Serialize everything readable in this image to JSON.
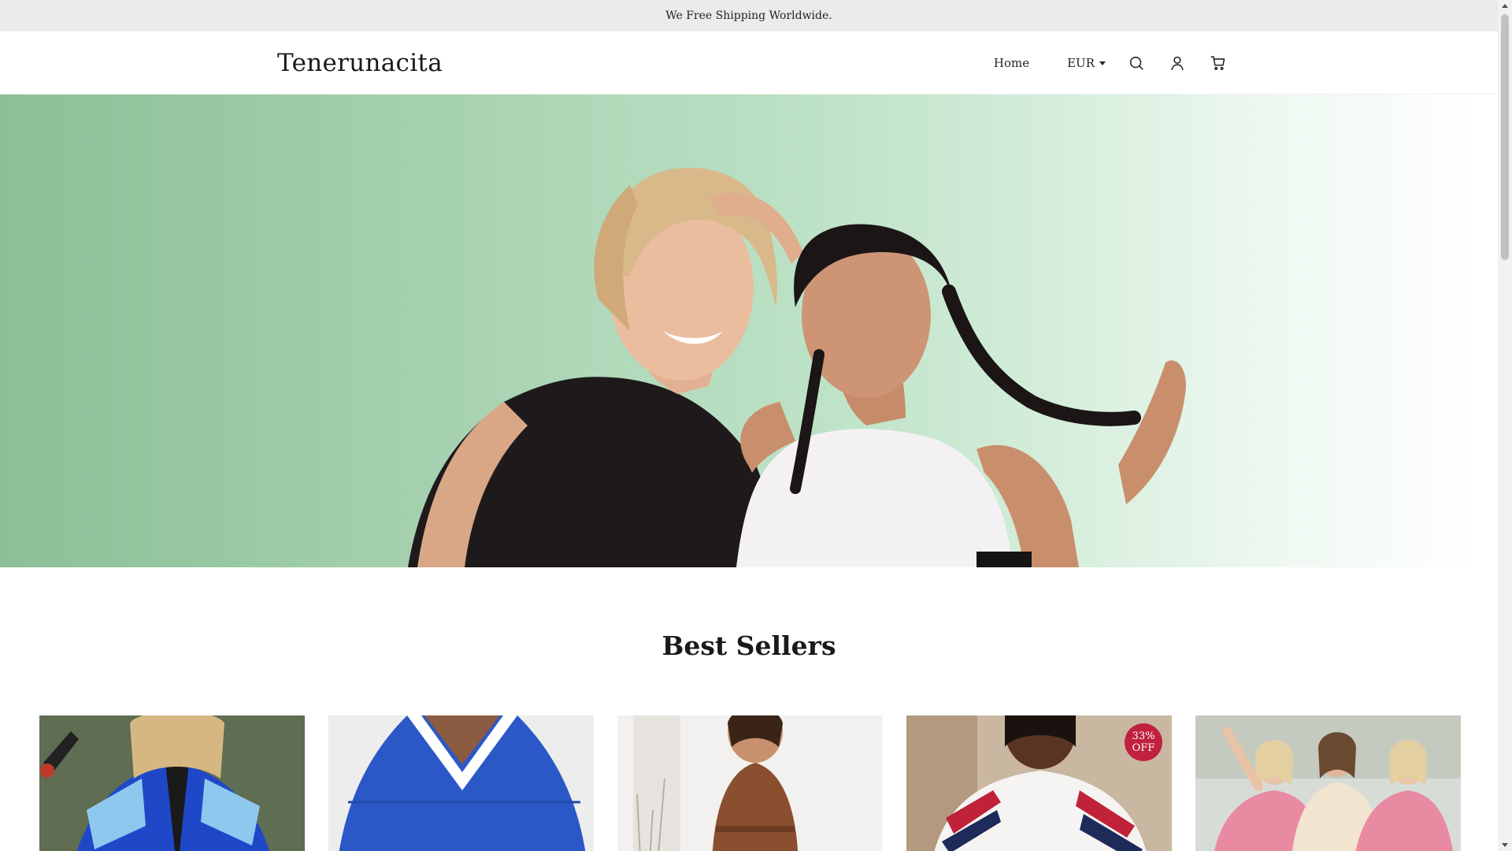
{
  "announcement": {
    "text": "We Free Shipping Worldwide."
  },
  "header": {
    "logo": "Tenerunacita",
    "nav": {
      "home_label": "Home"
    },
    "currency": {
      "selected": "EUR"
    },
    "icons": [
      "search-icon",
      "account-icon",
      "cart-icon"
    ]
  },
  "hero": {
    "image": "two-women-in-tank-tops-on-green-gradient"
  },
  "best_sellers": {
    "title": "Best Sellers",
    "products": [
      {
        "image": "woman-in-blue-colorblock-zip-jacket"
      },
      {
        "image": "blue-v-neck-sweatshirt"
      },
      {
        "image": "brown-textured-two-piece-set"
      },
      {
        "image": "white-navy-red-stripe-cardigan",
        "badge": "33%\nOFF"
      },
      {
        "image": "three-women-in-pink-and-cream-sweaters"
      }
    ]
  },
  "colors": {
    "hero_green": "#8bc096",
    "badge_red": "#c0213f",
    "announce_bg": "#ebebeb"
  }
}
